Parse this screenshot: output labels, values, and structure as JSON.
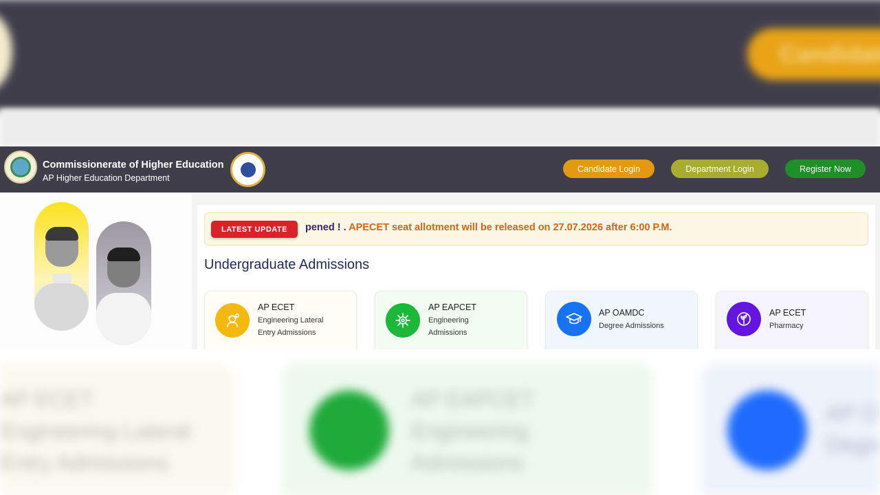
{
  "header": {
    "title": "Commissionerate of Higher Education",
    "subtitle": "AP Higher Education Department",
    "buttons": {
      "candidate_login": "Candidate Login",
      "department_login": "Department Login",
      "register_now": "Register Now"
    }
  },
  "ticker": {
    "badge": "LATEST UPDATE",
    "text_part1": "pened ! . ",
    "text_part2": "APECET seat allotment will be released on 27.07.2026 after 6:00 P.M."
  },
  "section": {
    "title": "Undergraduate Admissions"
  },
  "cards": [
    {
      "title": "AP ECET",
      "line1": "Engineering Lateral",
      "line2": "Entry Admissions",
      "icon": "engineer-icon"
    },
    {
      "title": "AP EAPCET",
      "line1": "Engineering",
      "line2": "Admissions",
      "icon": "circuit-gear-icon"
    },
    {
      "title": "AP OAMDC",
      "line1": "Degree Admissions",
      "icon": "graduation-cap-icon"
    },
    {
      "title": "AP ECET",
      "line1": "Pharmacy",
      "icon": "leaf-icon"
    }
  ],
  "background_blur": {
    "top_button": "Candidate",
    "card1": [
      "AP ECET",
      "Engineering Lateral",
      "Entry Admissions"
    ],
    "card2": [
      "AP EAPCET",
      "Engineering",
      "Admissions"
    ],
    "card3": [
      "AP O",
      "Degre"
    ]
  },
  "colors": {
    "header_bg": "#413e4c",
    "candidate": "#e39a10",
    "department": "#a8ad2f",
    "register": "#1f8f28",
    "badge": "#d9222a",
    "ticker_text": "#d0651a"
  }
}
